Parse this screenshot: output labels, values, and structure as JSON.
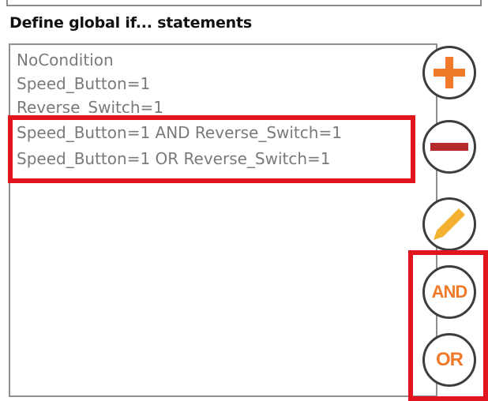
{
  "section_title": "Define global if... statements",
  "conditions": [
    "NoCondition",
    "Speed_Button=1",
    "Reverse_Switch=1",
    "Speed_Button=1 AND Reverse_Switch=1",
    "Speed_Button=1 OR Reverse_Switch=1"
  ],
  "buttons": {
    "add_icon": "plus-icon",
    "remove_icon": "minus-icon",
    "edit_icon": "pencil-icon",
    "and_label": "AND",
    "or_label": "OR"
  },
  "colors": {
    "accent_orange": "#f07a2a",
    "remove_red": "#b52a2a",
    "pencil_yellow": "#f2b230",
    "highlight_red": "#e2141e"
  }
}
